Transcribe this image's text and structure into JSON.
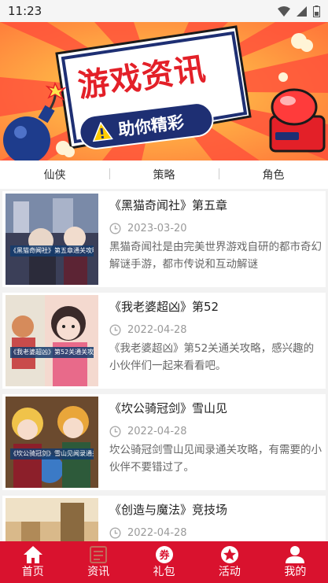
{
  "status_bar": {
    "time": "11:23"
  },
  "banner": {
    "title": "游戏资讯",
    "subtitle": "助你精彩"
  },
  "category_tabs": [
    "仙侠",
    "策略",
    "角色"
  ],
  "news": [
    {
      "title": "《黑猫奇闻社》第五章",
      "date": "2023-03-20",
      "desc": "黑猫奇闻社是由完美世界游戏自研的都市奇幻解谜手游，都市传说和互动解谜",
      "thumb_caption": "《黑猫奇闻社》第五章通关攻略"
    },
    {
      "title": "《我老婆超凶》第52",
      "date": "2022-04-28",
      "desc": "《我老婆超凶》第52关通关攻略，感兴趣的小伙伴们一起来看看吧。",
      "thumb_caption": "《我老婆超凶》第52关通关攻略"
    },
    {
      "title": "《坎公骑冠剑》雪山见",
      "date": "2022-04-28",
      "desc": "坎公骑冠剑雪山见闻录通关攻略，有需要的小伙伴不要错过了。",
      "thumb_caption": "《坎公骑冠剑》雪山见闻录通关攻略"
    },
    {
      "title": "《创造与魔法》竞技场",
      "date": "2022-04-28",
      "desc": "",
      "thumb_caption": ""
    }
  ],
  "bottom_nav": [
    {
      "label": "首页",
      "icon": "home-icon"
    },
    {
      "label": "资讯",
      "icon": "news-icon"
    },
    {
      "label": "礼包",
      "icon": "coupon-icon"
    },
    {
      "label": "活动",
      "icon": "activity-icon"
    },
    {
      "label": "我的",
      "icon": "user-icon"
    }
  ],
  "colors": {
    "accent": "#d9122e",
    "banner_pill": "#1e2f73",
    "title_red": "#e32028"
  }
}
